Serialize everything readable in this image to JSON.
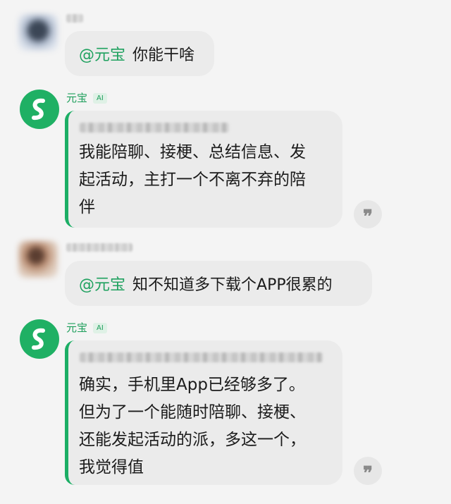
{
  "conversation": {
    "bot": {
      "name": "元宝",
      "badge": "AI"
    },
    "messages": [
      {
        "mention": "@元宝",
        "text": "你能干啥"
      },
      {
        "lines": [
          "我能陪聊、接梗、总结信息、发",
          "起活动，主打一个不离不弃的陪",
          "伴"
        ]
      },
      {
        "mention": "@元宝",
        "text": "知不知道多下载个APP很累的"
      },
      {
        "lines": [
          "确实，手机里App已经够多了。",
          "但为了一个能随时陪聊、接梗、",
          "还能发起活动的派，多这一个，",
          "我觉得值"
        ]
      }
    ]
  },
  "colors": {
    "accent": "#1cae65",
    "mention": "#1fa15f",
    "bubble": "#ebebeb",
    "background": "#f4f4f4"
  },
  "icons": {
    "bot_avatar": "yuanbao-logo-icon",
    "quote_button": "quote-icon"
  }
}
